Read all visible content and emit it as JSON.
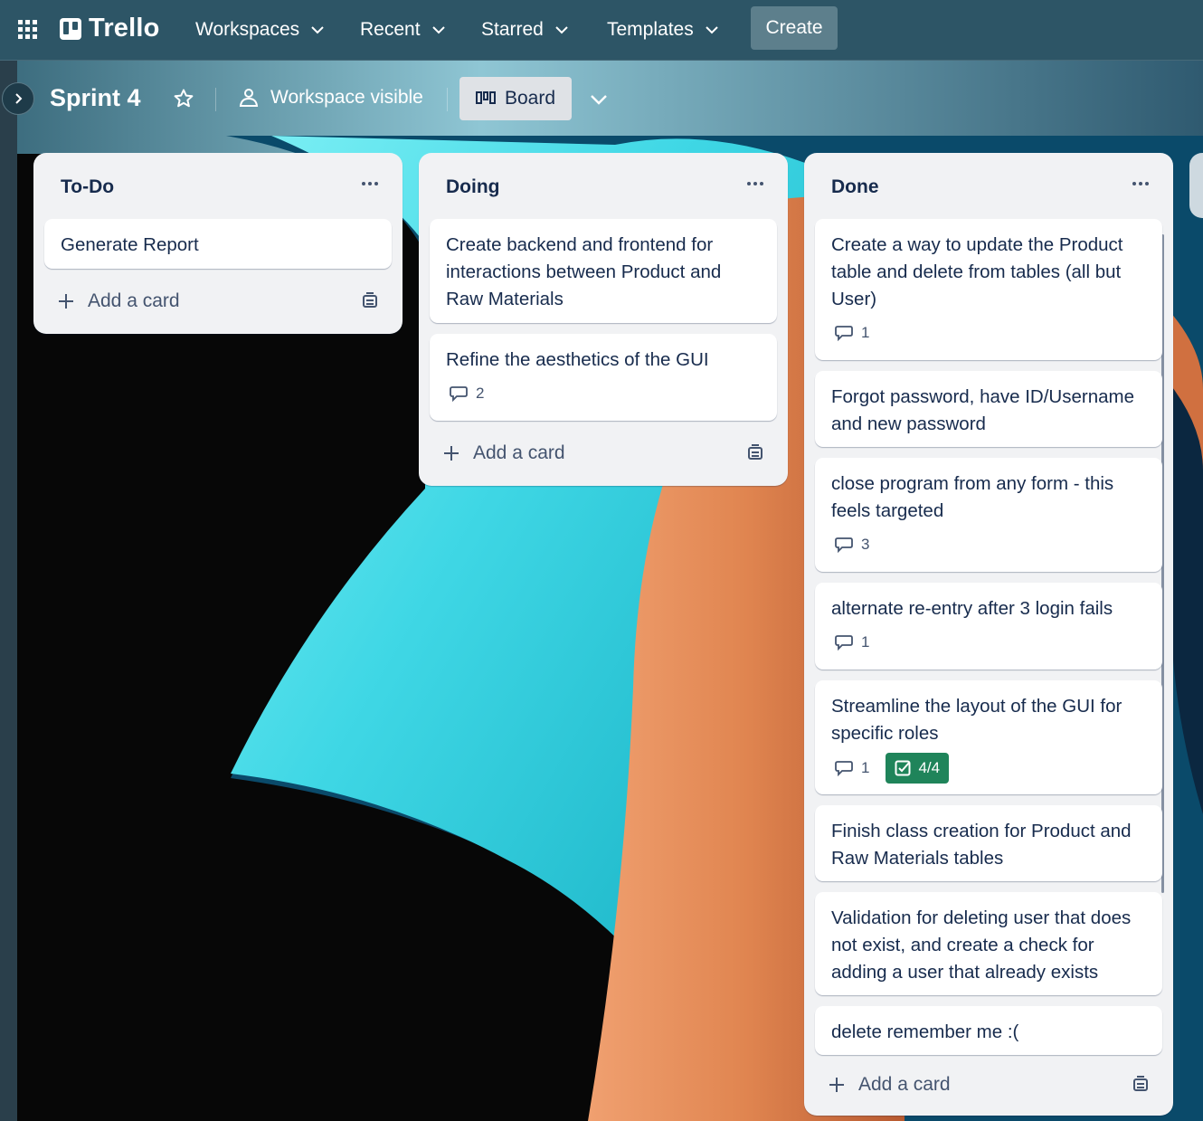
{
  "nav": {
    "brand": "Trello",
    "items": [
      {
        "label": "Workspaces"
      },
      {
        "label": "Recent"
      },
      {
        "label": "Starred"
      },
      {
        "label": "Templates"
      }
    ],
    "create_label": "Create"
  },
  "board": {
    "title": "Sprint 4",
    "visibility": "Workspace visible",
    "view_label": "Board"
  },
  "lists": [
    {
      "title": "To-Do",
      "cards": [
        {
          "text": "Generate Report"
        }
      ],
      "add_label": "Add a card"
    },
    {
      "title": "Doing",
      "cards": [
        {
          "text": "Create backend and frontend for interactions between Product and Raw Materials"
        },
        {
          "text": "Refine the aesthetics of the GUI",
          "comments": "2"
        }
      ],
      "add_label": "Add a card"
    },
    {
      "title": "Done",
      "cards": [
        {
          "text": "Create a way to update the Product table and delete from tables (all but User)",
          "comments": "1"
        },
        {
          "text": "Forgot password, have ID/Username and new password"
        },
        {
          "text": "close program from any form - this feels targeted",
          "comments": "3"
        },
        {
          "text": "alternate re-entry after 3 login fails",
          "comments": "1"
        },
        {
          "text": "Streamline the layout of the GUI for specific roles",
          "comments": "1",
          "checklist": "4/4"
        },
        {
          "text": "Finish class creation for Product and Raw Materials tables"
        },
        {
          "text": "Validation for deleting user that does not exist, and create a check for adding a user that already exists"
        },
        {
          "text": "delete remember me :("
        }
      ],
      "add_label": "Add a card"
    }
  ],
  "colors": {
    "nav_bg": "#2d5566",
    "list_bg": "#f1f2f4",
    "checklist_complete": "#1f845a"
  }
}
